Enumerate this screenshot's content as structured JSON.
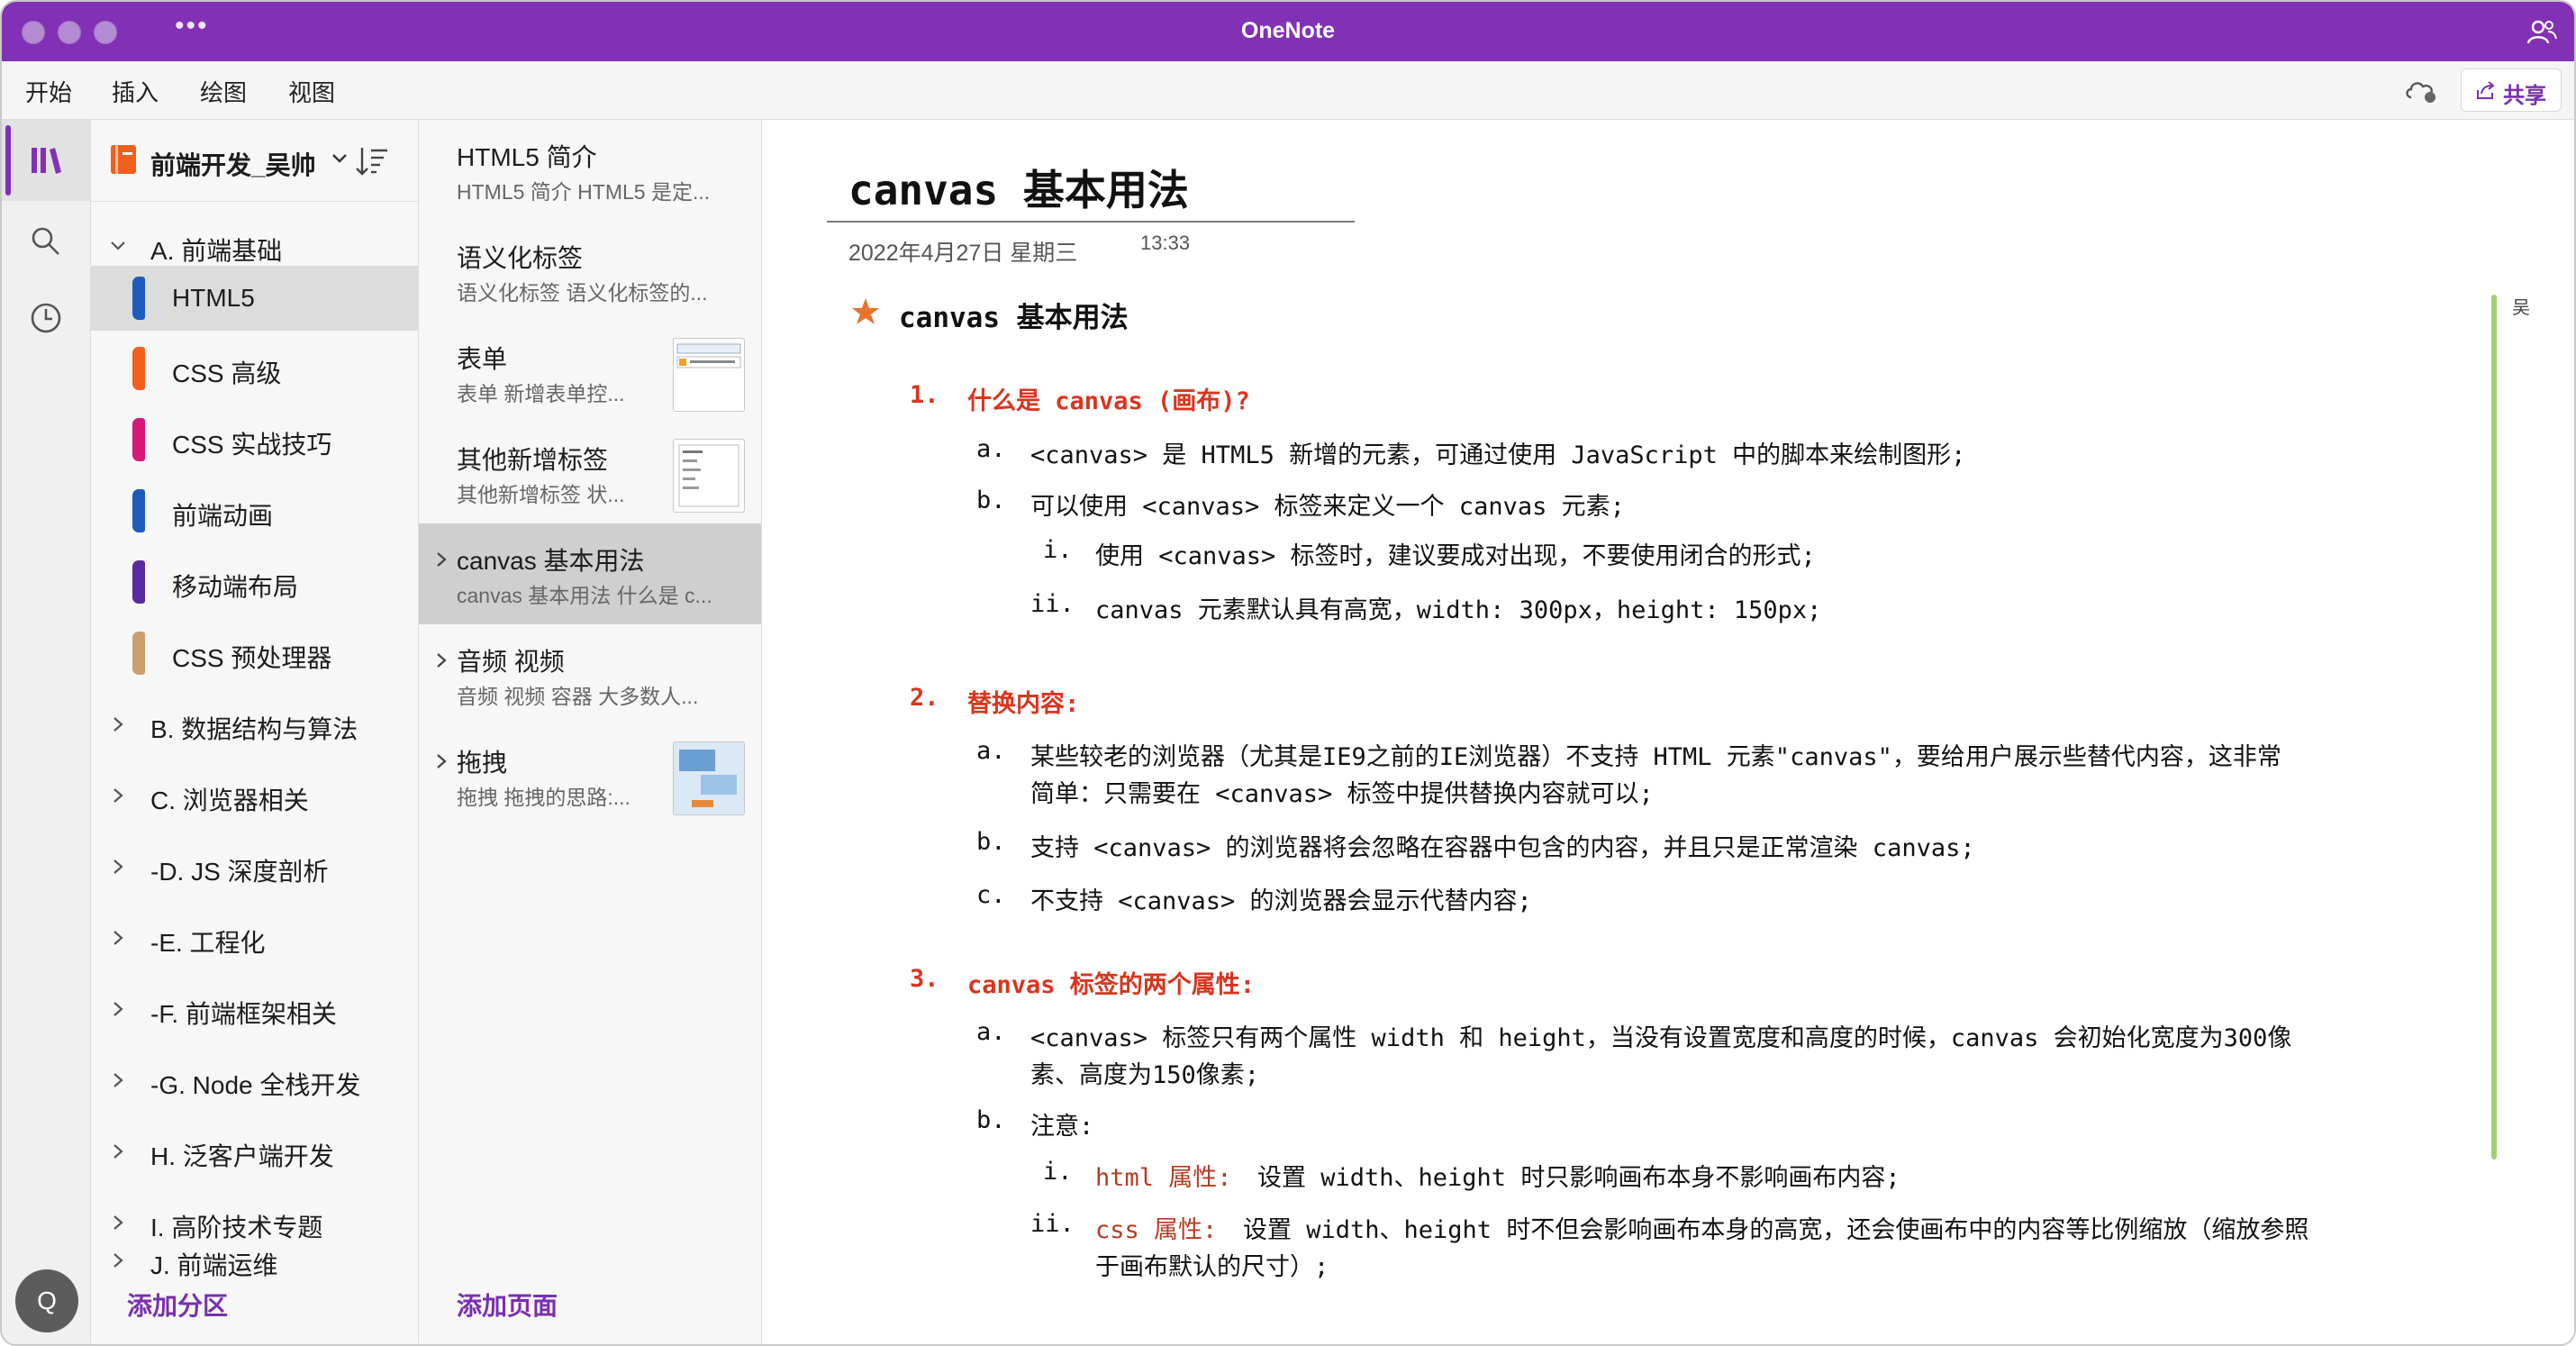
{
  "app": {
    "title": "OneNote",
    "more": "•••"
  },
  "ribbon": {
    "tabs": [
      "开始",
      "插入",
      "绘图",
      "视图"
    ],
    "share_label": "共享"
  },
  "rail": {
    "avatar_initial": "Q"
  },
  "notebook": {
    "name": "前端开发_吴帅",
    "add_section_label": "添加分区",
    "sections": [
      {
        "label": "A. 前端基础",
        "type": "group",
        "expanded": true
      },
      {
        "label": "HTML5",
        "type": "section",
        "color": "#1f5bbf",
        "selected": true
      },
      {
        "label": "CSS 高级",
        "type": "section",
        "color": "#f0601c"
      },
      {
        "label": "CSS 实战技巧",
        "type": "section",
        "color": "#d8177a"
      },
      {
        "label": "前端动画",
        "type": "section",
        "color": "#1f5bbf"
      },
      {
        "label": "移动端布局",
        "type": "section",
        "color": "#5a2aa0"
      },
      {
        "label": "CSS 预处理器",
        "type": "section",
        "color": "#c9a06e"
      },
      {
        "label": "B. 数据结构与算法",
        "type": "group"
      },
      {
        "label": "C. 浏览器相关",
        "type": "group"
      },
      {
        "label": "-D. JS 深度剖析",
        "type": "group"
      },
      {
        "label": "-E. 工程化",
        "type": "group"
      },
      {
        "label": "-F. 前端框架相关",
        "type": "group"
      },
      {
        "label": "-G. Node 全栈开发",
        "type": "group"
      },
      {
        "label": "H. 泛客户端开发",
        "type": "group"
      },
      {
        "label": "I. 高阶技术专题",
        "type": "group"
      },
      {
        "label": "J. 前端运维",
        "type": "group"
      }
    ]
  },
  "pages": {
    "add_page_label": "添加页面",
    "items": [
      {
        "title": "HTML5 简介",
        "preview": "HTML5 简介  HTML5 是定...",
        "thumb": false,
        "chevron": false
      },
      {
        "title": "语义化标签",
        "preview": "语义化标签  语义化标签的...",
        "thumb": false,
        "chevron": false
      },
      {
        "title": "表单",
        "preview": "表单  新增表单控...",
        "thumb": true,
        "chevron": false
      },
      {
        "title": "其他新增标签",
        "preview": "其他新增标签  状...",
        "thumb": true,
        "chevron": false
      },
      {
        "title": "canvas 基本用法",
        "preview": "canvas 基本用法  什么是 c...",
        "thumb": false,
        "chevron": true,
        "selected": true
      },
      {
        "title": "音频 视频",
        "preview": "音频 视频  容器  大多数人...",
        "thumb": false,
        "chevron": true
      },
      {
        "title": "拖拽",
        "preview": "拖拽  拖拽的思路:...",
        "thumb": true,
        "chevron": true
      }
    ]
  },
  "note": {
    "title": "canvas 基本用法",
    "date": "2022年4月27日 星期三",
    "time": "13:33",
    "author": "吴",
    "heading": "canvas 基本用法",
    "s1": {
      "num": "1.",
      "title": "什么是 canvas (画布)?",
      "a_num": "a.",
      "a": "<canvas> 是 HTML5 新增的元素，可通过使用 JavaScript 中的脚本来绘制图形;",
      "b_num": "b.",
      "b": "可以使用 <canvas> 标签来定义一个 canvas 元素;",
      "i_num": "i.",
      "i": "使用 <canvas> 标签时，建议要成对出现，不要使用闭合的形式;",
      "ii_num": "ii.",
      "ii": "canvas 元素默认具有高宽，width: 300px，height: 150px;"
    },
    "s2": {
      "num": "2.",
      "title": "替换内容:",
      "a_num": "a.",
      "a1": "某些较老的浏览器（尤其是IE9之前的IE浏览器）不支持 HTML 元素\"canvas\"，要给用户展示些替代内容，这非常",
      "a2": "简单：只需要在 <canvas> 标签中提供替换内容就可以;",
      "b_num": "b.",
      "b": "支持 <canvas> 的浏览器将会忽略在容器中包含的内容，并且只是正常渲染 canvas;",
      "c_num": "c.",
      "c": "不支持 <canvas> 的浏览器会显示代替内容;"
    },
    "s3": {
      "num": "3.",
      "title": "canvas 标签的两个属性:",
      "a_num": "a.",
      "a1": "<canvas> 标签只有两个属性 width 和 height，当没有设置宽度和高度的时候，canvas 会初始化宽度为300像",
      "a2": "素、高度为150像素;",
      "b_num": "b.",
      "b": "注意:",
      "i_num": "i.",
      "i_label": "html 属性:",
      "i_text": "设置 width、height 时只影响画布本身不影响画布内容;",
      "ii_num": "ii.",
      "ii_label": "css 属性:",
      "ii_text1": "设置 width、height 时不但会影响画布本身的高宽，还会使画布中的内容等比例缩放（缩放参照",
      "ii_text2": "于画布默认的尺寸）;"
    }
  },
  "colors": {
    "brand": "#8230b6",
    "accent_text": "#7a2fb0",
    "heading_red": "#d9351f",
    "margin_bar": "#9ed369"
  }
}
